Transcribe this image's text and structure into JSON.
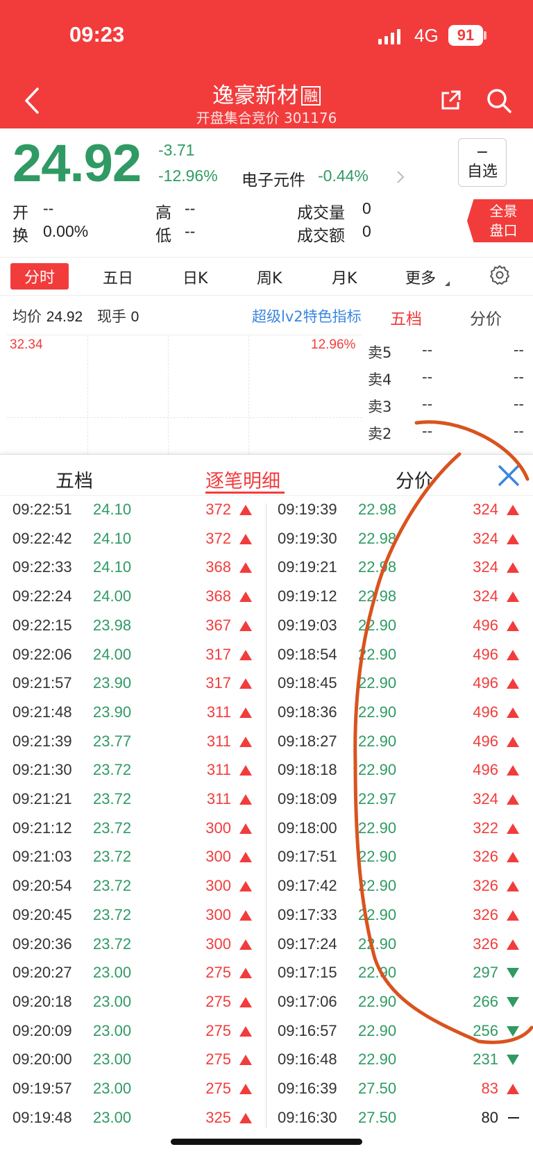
{
  "status": {
    "time": "09:23",
    "network": "4G",
    "battery": "91"
  },
  "header": {
    "title": "逸豪新材",
    "badge": "融",
    "subtitle": "开盘集合竞价 301176"
  },
  "quote": {
    "price": "24.92",
    "change": "-3.71",
    "change_pct": "-12.96%",
    "sector": "电子元件",
    "sector_pct": "-0.44%",
    "watch_sign": "−",
    "watch_label": "自选",
    "open_label": "开",
    "open": "--",
    "high_label": "高",
    "high": "--",
    "volume_label": "成交量",
    "volume": "0",
    "turnover_label": "换",
    "turnover": "0.00%",
    "low_label": "低",
    "low": "--",
    "amount_label": "成交额",
    "amount": "0",
    "panorama_1": "全景",
    "panorama_2": "盘口"
  },
  "tabs": [
    "分时",
    "五日",
    "日K",
    "周K",
    "月K",
    "更多"
  ],
  "info": {
    "avg_label": "均价",
    "avg": "24.92",
    "hand_label": "现手",
    "hand": "0",
    "lv2": "超级lv2特色指标",
    "side_tab_1": "五档",
    "side_tab_2": "分价",
    "chart_high": "32.34",
    "chart_pct": "12.96%"
  },
  "asks": [
    {
      "label": "卖5",
      "price": "--",
      "vol": "--"
    },
    {
      "label": "卖4",
      "price": "--",
      "vol": "--"
    },
    {
      "label": "卖3",
      "price": "--",
      "vol": "--"
    },
    {
      "label": "卖2",
      "price": "--",
      "vol": "--"
    }
  ],
  "sheet": {
    "tab_1": "五档",
    "tab_2": "逐笔明细",
    "tab_3": "分价"
  },
  "trades_left": [
    {
      "time": "09:22:51",
      "price": "24.10",
      "vol": "372",
      "dir": "up"
    },
    {
      "time": "09:22:42",
      "price": "24.10",
      "vol": "372",
      "dir": "up"
    },
    {
      "time": "09:22:33",
      "price": "24.10",
      "vol": "368",
      "dir": "up"
    },
    {
      "time": "09:22:24",
      "price": "24.00",
      "vol": "368",
      "dir": "up"
    },
    {
      "time": "09:22:15",
      "price": "23.98",
      "vol": "367",
      "dir": "up"
    },
    {
      "time": "09:22:06",
      "price": "24.00",
      "vol": "317",
      "dir": "up"
    },
    {
      "time": "09:21:57",
      "price": "23.90",
      "vol": "317",
      "dir": "up"
    },
    {
      "time": "09:21:48",
      "price": "23.90",
      "vol": "311",
      "dir": "up"
    },
    {
      "time": "09:21:39",
      "price": "23.77",
      "vol": "311",
      "dir": "up"
    },
    {
      "time": "09:21:30",
      "price": "23.72",
      "vol": "311",
      "dir": "up"
    },
    {
      "time": "09:21:21",
      "price": "23.72",
      "vol": "311",
      "dir": "up"
    },
    {
      "time": "09:21:12",
      "price": "23.72",
      "vol": "300",
      "dir": "up"
    },
    {
      "time": "09:21:03",
      "price": "23.72",
      "vol": "300",
      "dir": "up"
    },
    {
      "time": "09:20:54",
      "price": "23.72",
      "vol": "300",
      "dir": "up"
    },
    {
      "time": "09:20:45",
      "price": "23.72",
      "vol": "300",
      "dir": "up"
    },
    {
      "time": "09:20:36",
      "price": "23.72",
      "vol": "300",
      "dir": "up"
    },
    {
      "time": "09:20:27",
      "price": "23.00",
      "vol": "275",
      "dir": "up"
    },
    {
      "time": "09:20:18",
      "price": "23.00",
      "vol": "275",
      "dir": "up"
    },
    {
      "time": "09:20:09",
      "price": "23.00",
      "vol": "275",
      "dir": "up"
    },
    {
      "time": "09:20:00",
      "price": "23.00",
      "vol": "275",
      "dir": "up"
    },
    {
      "time": "09:19:57",
      "price": "23.00",
      "vol": "275",
      "dir": "up"
    },
    {
      "time": "09:19:48",
      "price": "23.00",
      "vol": "325",
      "dir": "up"
    }
  ],
  "trades_right": [
    {
      "time": "09:19:39",
      "price": "22.98",
      "vol": "324",
      "dir": "up"
    },
    {
      "time": "09:19:30",
      "price": "22.98",
      "vol": "324",
      "dir": "up"
    },
    {
      "time": "09:19:21",
      "price": "22.98",
      "vol": "324",
      "dir": "up"
    },
    {
      "time": "09:19:12",
      "price": "22.98",
      "vol": "324",
      "dir": "up"
    },
    {
      "time": "09:19:03",
      "price": "22.90",
      "vol": "496",
      "dir": "up"
    },
    {
      "time": "09:18:54",
      "price": "22.90",
      "vol": "496",
      "dir": "up"
    },
    {
      "time": "09:18:45",
      "price": "22.90",
      "vol": "496",
      "dir": "up"
    },
    {
      "time": "09:18:36",
      "price": "22.90",
      "vol": "496",
      "dir": "up"
    },
    {
      "time": "09:18:27",
      "price": "22.90",
      "vol": "496",
      "dir": "up"
    },
    {
      "time": "09:18:18",
      "price": "22.90",
      "vol": "496",
      "dir": "up"
    },
    {
      "time": "09:18:09",
      "price": "22.97",
      "vol": "324",
      "dir": "up"
    },
    {
      "time": "09:18:00",
      "price": "22.90",
      "vol": "322",
      "dir": "up"
    },
    {
      "time": "09:17:51",
      "price": "22.90",
      "vol": "326",
      "dir": "up"
    },
    {
      "time": "09:17:42",
      "price": "22.90",
      "vol": "326",
      "dir": "up"
    },
    {
      "time": "09:17:33",
      "price": "22.90",
      "vol": "326",
      "dir": "up"
    },
    {
      "time": "09:17:24",
      "price": "22.90",
      "vol": "326",
      "dir": "up"
    },
    {
      "time": "09:17:15",
      "price": "22.90",
      "vol": "297",
      "dir": "down"
    },
    {
      "time": "09:17:06",
      "price": "22.90",
      "vol": "266",
      "dir": "down"
    },
    {
      "time": "09:16:57",
      "price": "22.90",
      "vol": "256",
      "dir": "down"
    },
    {
      "time": "09:16:48",
      "price": "22.90",
      "vol": "231",
      "dir": "down"
    },
    {
      "time": "09:16:39",
      "price": "27.50",
      "vol": "83",
      "dir": "up"
    },
    {
      "time": "09:16:30",
      "price": "27.50",
      "vol": "80",
      "dir": "flat"
    }
  ],
  "colors": {
    "brand_red": "#f23c3c",
    "down_green": "#2f9a63",
    "link_blue": "#3a86e0",
    "annotation_orange": "#d9531e"
  }
}
